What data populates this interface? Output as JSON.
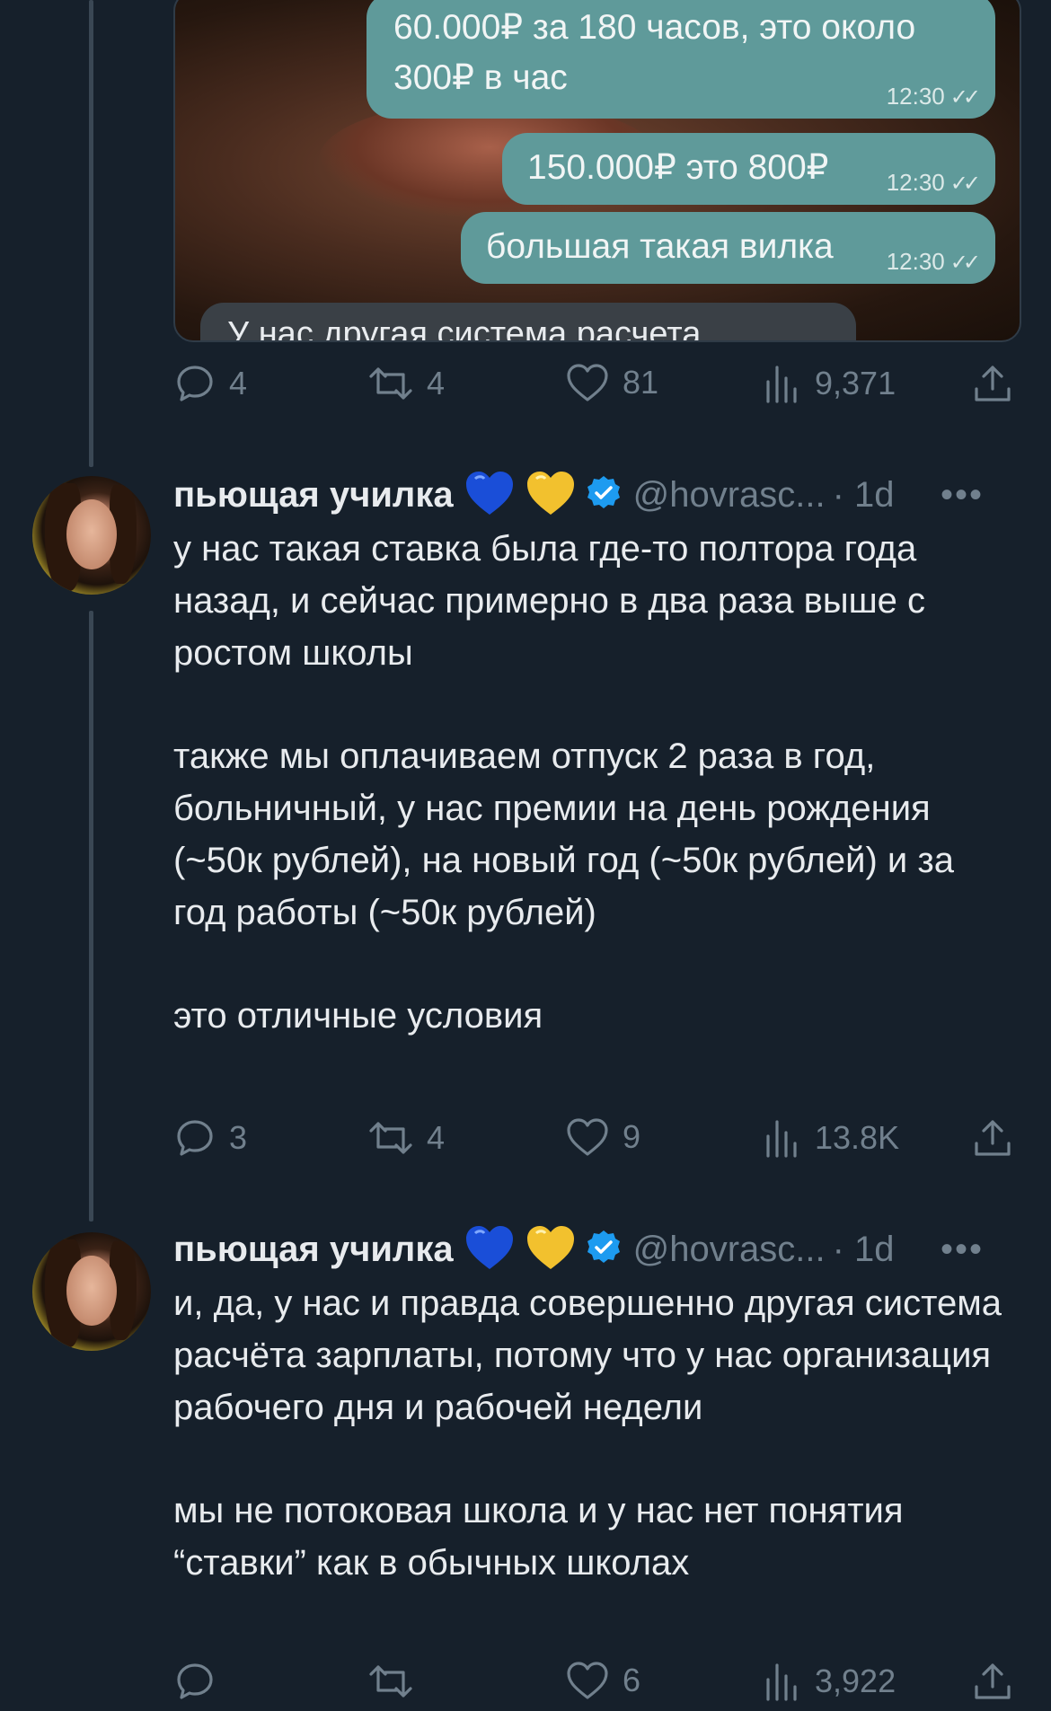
{
  "chat_media": {
    "bubbles": [
      {
        "text_l1": "60.000₽ за 180 часов, это около",
        "text_l2": "300₽ в час",
        "time": "12:30"
      },
      {
        "text": "150.000₽ это 800₽",
        "time": "12:30"
      },
      {
        "text": "большая такая вилка",
        "time": "12:30"
      }
    ],
    "partial_bubble": "У нас другая система расчета"
  },
  "tweet0_actions": {
    "replies": "4",
    "retweets": "4",
    "likes": "81",
    "views": "9,371"
  },
  "tweet1": {
    "name": "пьющая училка",
    "emoji1": "💙",
    "emoji2": "💛",
    "handle": "@hovrasc...",
    "time": "· 1d",
    "para1": "у нас такая ставка была где-то полтора года назад, и сейчас примерно в два раза выше с ростом школы",
    "para2": "также мы оплачиваем отпуск 2 раза в год, больничный, у нас премии на день рождения (~50к рублей), на новый год (~50к рублей) и за год работы (~50к рублей)",
    "para3": "это отличные условия",
    "actions": {
      "replies": "3",
      "retweets": "4",
      "likes": "9",
      "views": "13.8K"
    }
  },
  "tweet2": {
    "name": "пьющая училка",
    "emoji1": "💙",
    "emoji2": "💛",
    "handle": "@hovrasc...",
    "time": "· 1d",
    "para1": "и, да, у нас и правда совершенно другая система расчёта зарплаты, потому что у нас организация рабочего дня и рабочей недели",
    "para2": "мы не потоковая школа и у нас нет понятия “ставки” как в обычных школах",
    "actions": {
      "replies": "",
      "retweets": "",
      "likes": "6",
      "views": "3,922"
    }
  },
  "icons": [
    "reply-icon",
    "retweet-icon",
    "like-icon",
    "views-icon",
    "share-icon",
    "verified-icon",
    "more-icon",
    "double-check-icon"
  ],
  "colors": {
    "background": "#16202b",
    "bubble": "#5f9a9a",
    "muted": "#71808d",
    "verified": "#1d9bf0"
  }
}
